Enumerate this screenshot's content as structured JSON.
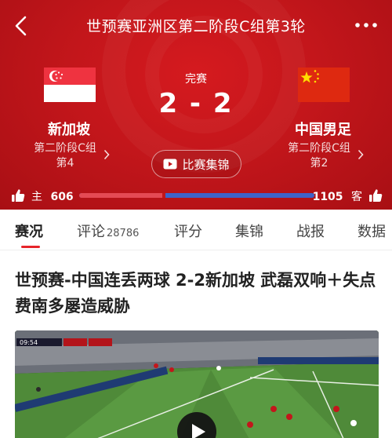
{
  "header": {
    "title": "世预赛亚洲区第二阶段C组第3轮"
  },
  "match": {
    "status": "完赛",
    "score": "2 - 2",
    "home": {
      "name": "新加坡",
      "group": "第二阶段C组",
      "rank": "第4"
    },
    "away": {
      "name": "中国男足",
      "group": "第二阶段C组",
      "rank": "第2"
    },
    "highlights_label": "比赛集锦"
  },
  "support": {
    "home_label": "主",
    "home_count": "606",
    "away_count": "1105",
    "away_label": "客",
    "home_share": 0.354
  },
  "tabs": [
    {
      "label": "赛况",
      "count": ""
    },
    {
      "label": "评论",
      "count": "28786"
    },
    {
      "label": "评分",
      "count": ""
    },
    {
      "label": "集锦",
      "count": ""
    },
    {
      "label": "战报",
      "count": ""
    },
    {
      "label": "数据",
      "count": ""
    }
  ],
  "article": {
    "headline": "世预赛-中国连丢两球 2-2新加坡 武磊双响＋失点费南多屡造威胁"
  },
  "video": {
    "score_overlay": "09:54"
  },
  "colors": {
    "hero_red": "#c3161b",
    "home_bar": "#e44a54",
    "away_bar": "#3f63c9",
    "tab_indicator": "#e6242a"
  },
  "icons": [
    "back-icon",
    "more-icon",
    "video-icon",
    "thumbs-up-icon",
    "play-icon",
    "chevron-right-icon"
  ]
}
